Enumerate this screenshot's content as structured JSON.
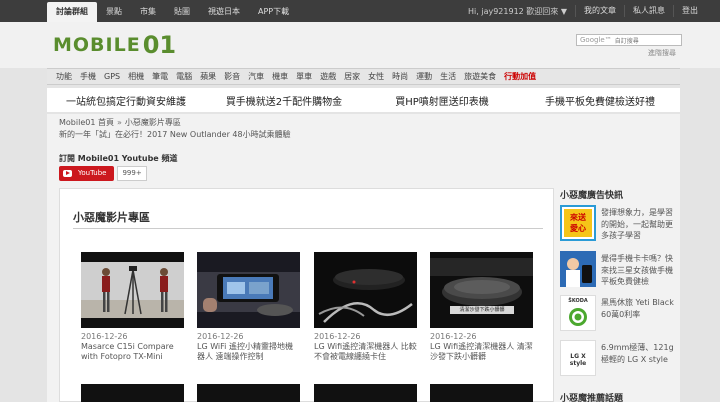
{
  "topnav": {
    "items": [
      "討論群組",
      "景點",
      "市集",
      "貼圖",
      "視遊日本",
      "APP下載"
    ],
    "user": "Hi, jay921912 歡迎回來 ▼",
    "links": [
      "我的文章",
      "私人訊息",
      "登出"
    ]
  },
  "header": {
    "logo_text": "MOBILE",
    "logo_num": "01",
    "search_google": "Google™",
    "search_label": "自訂搜尋",
    "advanced_search": "進階搜尋"
  },
  "catnav": {
    "items": [
      "功能",
      "手機",
      "GPS",
      "相機",
      "筆電",
      "電腦",
      "蘋果",
      "影音",
      "汽車",
      "機車",
      "單車",
      "遊戲",
      "居家",
      "女性",
      "時尚",
      "運動",
      "生活",
      "旅遊美食"
    ],
    "hot": "行動加值"
  },
  "promo": {
    "items": [
      "一站統包搞定行動資安維護",
      "買手機就送2千配件購物金",
      "買HP噴射匣送印表機",
      "手機平板免費健檢送好禮"
    ]
  },
  "main": {
    "breadcrumb": [
      "Mobile01 首頁",
      "»",
      "小惡魔影片專區"
    ],
    "headline": "新的一年「試」在必行！2017 New Outlander 48小時試乘體驗",
    "subscribe_title": "訂閱 Mobile01 Youtube 頻道",
    "youtube_label": "YouTube",
    "youtube_count": "999+",
    "panel_title": "小惡魔影片專區",
    "videos": [
      {
        "date": "2016-12-26",
        "title": "Masarce C15i Compare with Fotopro TX-Mini"
      },
      {
        "date": "2016-12-26",
        "title": "LG WiFi 遙控小精靈掃地機器人 遠端操作控制"
      },
      {
        "date": "2016-12-26",
        "title": "LG Wifi遙控清潔機器人 比較不會被電線纏繞卡住"
      },
      {
        "date": "2016-12-26",
        "title": "LG Wifi遙控清潔機器人 清潔沙發下跌小髒髒"
      }
    ],
    "video4_caption": "清潔沙發下跌小髒髒"
  },
  "sidebar": {
    "title": "小惡魔廣告快訊",
    "items": [
      {
        "thumb_text": "來送\n愛心",
        "text": "發揮想象力，是學習的開始，一起幫助更多孩子學習"
      },
      {
        "thumb_text": "",
        "text": "覺得手機卡卡嗎？快來找三星女孩做手機平板免費健檢"
      },
      {
        "thumb_text": "ŠKODA",
        "text": "黑馬休旅 Yeti Black 60萬0利率"
      },
      {
        "thumb_text": "LG X style",
        "text": "6.9mm極薄、121g極輕的 LG X style"
      }
    ],
    "bottom_title": "小惡魔推薦話題"
  },
  "colors": {
    "brand_green": "#5a8d2e",
    "youtube_red": "#cc181e",
    "topbar": "#3d3d3d"
  }
}
